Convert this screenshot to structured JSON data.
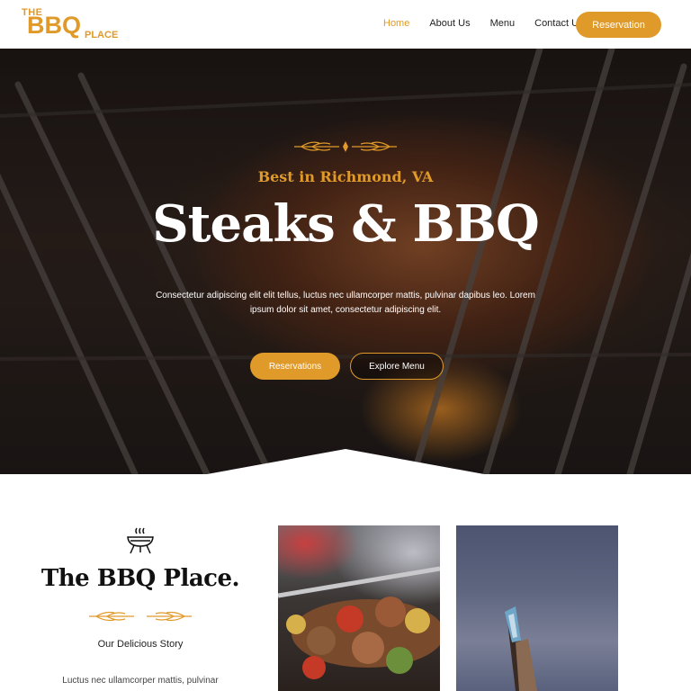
{
  "brand": {
    "the": "THE",
    "bbq": "BBQ",
    "place": "PLACE"
  },
  "nav": {
    "items": [
      {
        "label": "Home",
        "active": true
      },
      {
        "label": "About Us",
        "active": false
      },
      {
        "label": "Menu",
        "active": false
      },
      {
        "label": "Contact Us",
        "active": false
      }
    ],
    "cta_label": "Reservation"
  },
  "hero": {
    "subtitle": "Best in Richmond, VA",
    "title": "Steaks & BBQ",
    "text": "Consectetur adipiscing elit elit tellus, luctus nec ullamcorper mattis, pulvinar dapibus leo. Lorem ipsum dolor sit amet, consectetur adipiscing elit.",
    "primary_button": "Reservations",
    "secondary_button": "Explore Menu"
  },
  "story": {
    "icon": "grill-icon",
    "title": "The BBQ Place.",
    "subtitle": "Our Delicious Story",
    "text": "Luctus nec ullamcorper mattis, pulvinar"
  },
  "colors": {
    "accent": "#e09a2a",
    "dark": "#111111",
    "white": "#ffffff"
  }
}
